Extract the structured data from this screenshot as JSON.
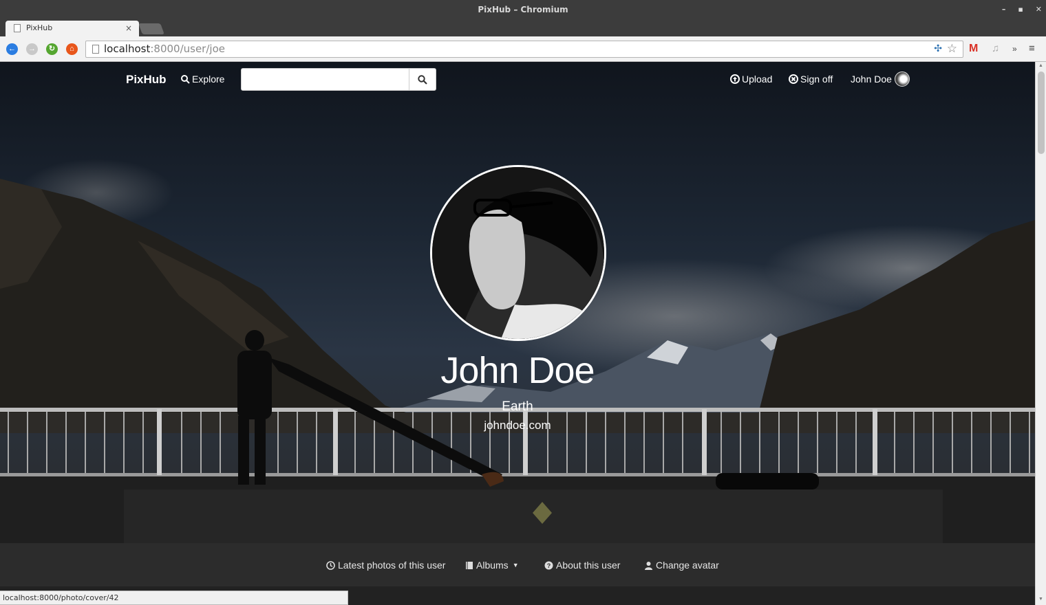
{
  "window": {
    "title": "PixHub – Chromium",
    "controls": [
      "–",
      "▪",
      "✕"
    ]
  },
  "tab": {
    "title": "PixHub",
    "close": "×"
  },
  "toolbar": {
    "url_host": "localhost",
    "url_path": ":8000/user/joe"
  },
  "site": {
    "brand": "PixHub",
    "explore": "Explore",
    "search_placeholder": "",
    "upload": "Upload",
    "signoff": "Sign off",
    "username": "John Doe"
  },
  "profile": {
    "name": "John Doe",
    "location": "Earth",
    "website": "johndoe.com"
  },
  "subnav": {
    "latest": "Latest photos of this user",
    "albums": "Albums",
    "about": "About this user",
    "change_avatar": "Change avatar"
  },
  "status": {
    "link": "localhost:8000/photo/cover/42"
  },
  "colors": {
    "accent_back": "#2b7de1",
    "accent_reload": "#55a630",
    "accent_home": "#e8561b",
    "gmail": "#d93025"
  }
}
